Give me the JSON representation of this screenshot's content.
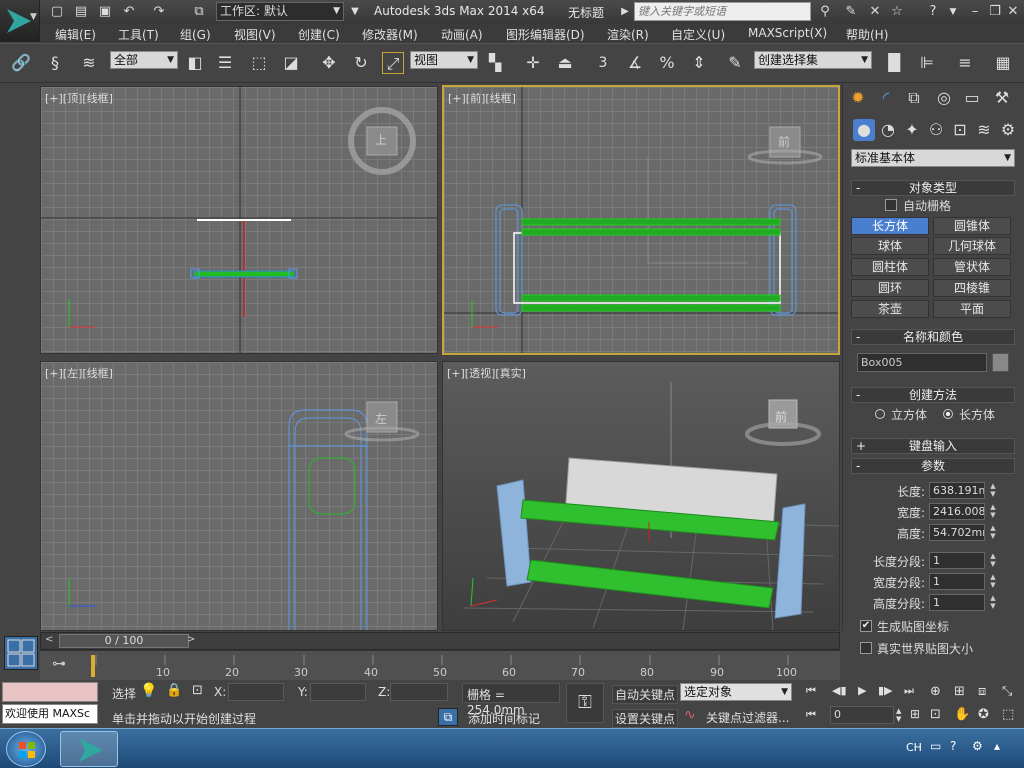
{
  "titlebar": {
    "workspace_value": "工作区: 默认",
    "app_title": "Autodesk 3ds Max  2014 x64",
    "doc_title": "无标题",
    "search_placeholder": "键入关键字或短语"
  },
  "menus": [
    "编辑(E)",
    "工具(T)",
    "组(G)",
    "视图(V)",
    "创建(C)",
    "修改器(M)",
    "动画(A)",
    "图形编辑器(D)",
    "渲染(R)",
    "自定义(U)",
    "MAXScript(X)",
    "帮助(H)"
  ],
  "toolbar": {
    "selection_filter": "全部",
    "ref_coord": "视图",
    "snap_label": "3",
    "named_selection": "创建选择集"
  },
  "viewports": {
    "top": {
      "label": "[+][顶][线框]",
      "cube": "上"
    },
    "front": {
      "label": "[+][前][线框]",
      "cube": "前"
    },
    "left": {
      "label": "[+][左][线框]",
      "cube": "左"
    },
    "persp": {
      "label": "[+][透视][真实]",
      "cube": "前"
    }
  },
  "command_panel": {
    "category": "标准基本体",
    "object_type": {
      "title": "对象类型",
      "autogrid": "自动栅格",
      "buttons": [
        "长方体",
        "圆锥体",
        "球体",
        "几何球体",
        "圆柱体",
        "管状体",
        "圆环",
        "四棱锥",
        "茶壶",
        "平面"
      ]
    },
    "name_color": {
      "title": "名称和颜色",
      "name": "Box005"
    },
    "creation_method": {
      "title": "创建方法",
      "opt1": "立方体",
      "opt2": "长方体"
    },
    "keyboard_entry": "键盘输入",
    "params": {
      "title": "参数",
      "length_label": "长度:",
      "length": "638.191m",
      "width_label": "宽度:",
      "width": "2416.008",
      "height_label": "高度:",
      "height": "54.702mn",
      "lseg_label": "长度分段:",
      "lseg": "1",
      "wseg_label": "宽度分段:",
      "wseg": "1",
      "hseg_label": "高度分段:",
      "hseg": "1",
      "gen_map": "生成贴图坐标",
      "real_world": "真实世界贴图大小"
    }
  },
  "timeline": {
    "frame": "0 / 100",
    "ticks": [
      "10",
      "20",
      "30",
      "40",
      "50",
      "60",
      "70",
      "80",
      "90",
      "100"
    ]
  },
  "status": {
    "welcome": "欢迎使用 MAXSc",
    "select_label": "选择",
    "x": "X:",
    "y": "Y:",
    "z": "Z:",
    "grid": "栅格 = 254.0mm",
    "prompt": "单击并拖动以开始创建过程",
    "add_time_tag": "添加时间标记",
    "auto_key": "自动关键点",
    "set_key": "设置关键点",
    "selected_object": "选定对象",
    "key_filter": "关键点过滤器...",
    "frame_input": "0"
  },
  "taskbar": {
    "lang": "CH"
  }
}
